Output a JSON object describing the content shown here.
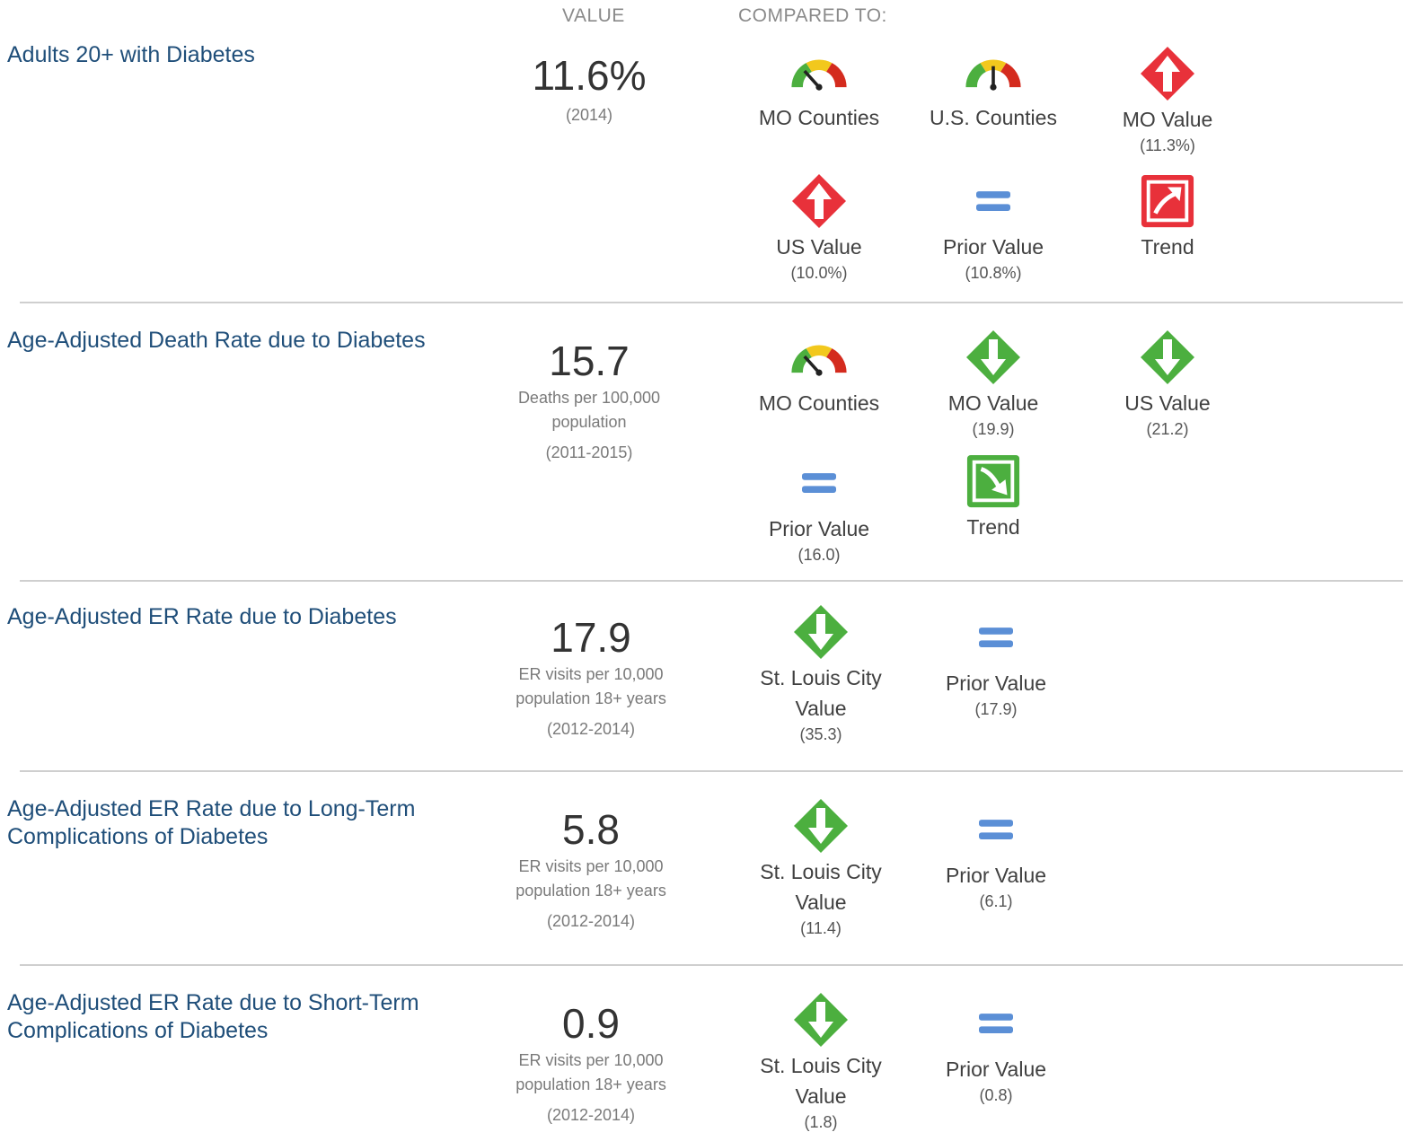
{
  "header": {
    "value": "VALUE",
    "compared_to": "COMPARED TO:"
  },
  "colors": {
    "title_blue": "#1f4e79",
    "bad_red": "#e8313a",
    "good_green": "#4caf3f",
    "neutral_blue": "#5b8fd6",
    "gauge_green": "#4caf3f",
    "gauge_yellow": "#f2c81d",
    "gauge_red": "#d42b1e"
  },
  "indicators": [
    {
      "title": "Adults 20+ with Diabetes",
      "value": "11.6%",
      "unit": "",
      "period": "(2014)",
      "comparisons": [
        {
          "icon": "gauge-icon",
          "label": "MO Counties",
          "value": ""
        },
        {
          "icon": "gauge-icon",
          "label": "U.S. Counties",
          "value": ""
        },
        {
          "icon": "red-up-arrow-icon",
          "label": "MO Value",
          "value": "(11.3%)"
        },
        {
          "icon": "red-up-arrow-icon",
          "label": "US Value",
          "value": "(10.0%)"
        },
        {
          "icon": "equals-icon",
          "label": "Prior Value",
          "value": "(10.8%)"
        },
        {
          "icon": "red-trend-up-icon",
          "label": "Trend",
          "value": ""
        }
      ]
    },
    {
      "title": "Age-Adjusted Death Rate due to Diabetes",
      "value": "15.7",
      "unit": "Deaths per 100,000 population",
      "period": "(2011-2015)",
      "comparisons": [
        {
          "icon": "gauge-icon",
          "label": "MO Counties",
          "value": ""
        },
        {
          "icon": "green-down-arrow-icon",
          "label": "MO Value",
          "value": "(19.9)"
        },
        {
          "icon": "green-down-arrow-icon",
          "label": "US Value",
          "value": "(21.2)"
        },
        {
          "icon": "equals-icon",
          "label": "Prior Value",
          "value": "(16.0)"
        },
        {
          "icon": "green-trend-down-icon",
          "label": "Trend",
          "value": ""
        }
      ]
    },
    {
      "title": "Age-Adjusted ER Rate due to Diabetes",
      "value": "17.9",
      "unit": "ER visits per 10,000 population 18+ years",
      "period": "(2012-2014)",
      "comparisons": [
        {
          "icon": "green-down-arrow-icon",
          "label": "St. Louis City Value",
          "value": "(35.3)"
        },
        {
          "icon": "equals-icon",
          "label": "Prior Value",
          "value": "(17.9)"
        }
      ]
    },
    {
      "title": "Age-Adjusted ER Rate due to Long-Term Complications of Diabetes",
      "value": "5.8",
      "unit": "ER visits per 10,000 population 18+ years",
      "period": "(2012-2014)",
      "comparisons": [
        {
          "icon": "green-down-arrow-icon",
          "label": "St. Louis City Value",
          "value": "(11.4)"
        },
        {
          "icon": "equals-icon",
          "label": "Prior Value",
          "value": "(6.1)"
        }
      ]
    },
    {
      "title": "Age-Adjusted ER Rate due to Short-Term Complications of Diabetes",
      "value": "0.9",
      "unit": "ER visits per 10,000 population 18+ years",
      "period": "(2012-2014)",
      "comparisons": [
        {
          "icon": "green-down-arrow-icon",
          "label": "St. Louis City Value",
          "value": "(1.8)"
        },
        {
          "icon": "equals-icon",
          "label": "Prior Value",
          "value": "(0.8)"
        }
      ]
    }
  ]
}
